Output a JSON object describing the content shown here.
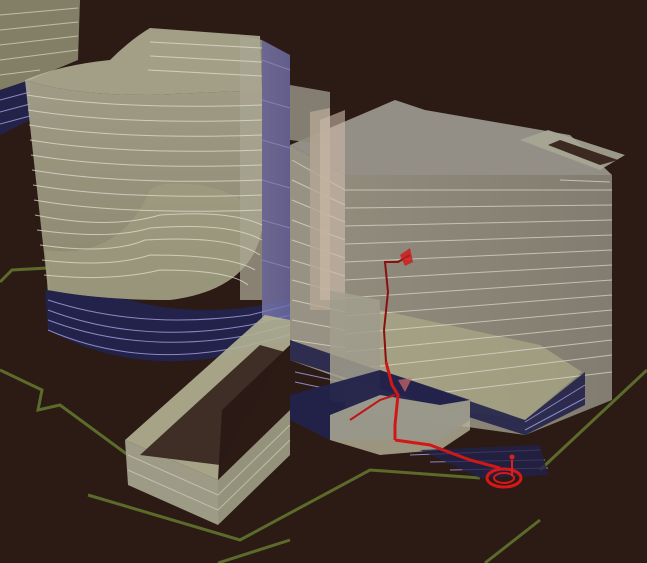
{
  "viewport": {
    "background": "#2c1a15"
  },
  "colors": {
    "ground_outline": "#5a6a2a",
    "podium_dark": "#23234a",
    "podium_line": "#8c88c0",
    "glass_face": "#a8a890",
    "glass_face_dark": "#8c8a78",
    "glass_top": "#b8b898",
    "floor_line": "#d8d4c8",
    "route_red": "#d01818",
    "route_red_dark": "#8a1010",
    "accent_blue": "#7b7bb8"
  },
  "scene": {
    "name": "3d-building-massing-view",
    "buildings": [
      "tower-left-partial",
      "tower-curved",
      "tower-right-block",
      "low-wing-bar",
      "link-block"
    ],
    "route": "evacuation-route",
    "marker": "person-marker"
  }
}
